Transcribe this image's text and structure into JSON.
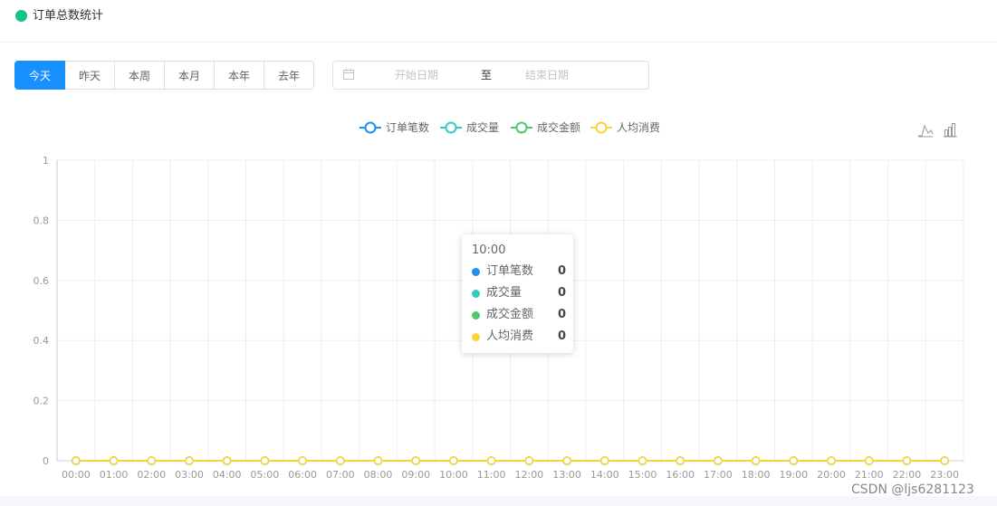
{
  "header": {
    "title": "订单总数统计",
    "dot_color": "#13c28b"
  },
  "buttons": [
    "今天",
    "昨天",
    "本周",
    "本月",
    "本年",
    "去年"
  ],
  "active_button": 0,
  "accent": "#1890ff",
  "date_range": {
    "start_placeholder": "开始日期",
    "separator": "至",
    "end_placeholder": "结束日期"
  },
  "toolbox": [
    "line-icon",
    "bar-icon"
  ],
  "chart_data": {
    "type": "line",
    "x": [
      "00:00",
      "01:00",
      "02:00",
      "03:00",
      "04:00",
      "05:00",
      "06:00",
      "07:00",
      "08:00",
      "09:00",
      "10:00",
      "11:00",
      "12:00",
      "13:00",
      "14:00",
      "15:00",
      "16:00",
      "17:00",
      "18:00",
      "19:00",
      "20:00",
      "21:00",
      "22:00",
      "23:00"
    ],
    "series": [
      {
        "name": "订单笔数",
        "color": "#1e90f0",
        "values": [
          0,
          0,
          0,
          0,
          0,
          0,
          0,
          0,
          0,
          0,
          0,
          0,
          0,
          0,
          0,
          0,
          0,
          0,
          0,
          0,
          0,
          0,
          0,
          0
        ]
      },
      {
        "name": "成交量",
        "color": "#36c9c6",
        "values": [
          0,
          0,
          0,
          0,
          0,
          0,
          0,
          0,
          0,
          0,
          0,
          0,
          0,
          0,
          0,
          0,
          0,
          0,
          0,
          0,
          0,
          0,
          0,
          0
        ]
      },
      {
        "name": "成交金额",
        "color": "#4fc96c",
        "values": [
          0,
          0,
          0,
          0,
          0,
          0,
          0,
          0,
          0,
          0,
          0,
          0,
          0,
          0,
          0,
          0,
          0,
          0,
          0,
          0,
          0,
          0,
          0,
          0
        ]
      },
      {
        "name": "人均消费",
        "color": "#fad337",
        "values": [
          0,
          0,
          0,
          0,
          0,
          0,
          0,
          0,
          0,
          0,
          0,
          0,
          0,
          0,
          0,
          0,
          0,
          0,
          0,
          0,
          0,
          0,
          0,
          0
        ]
      }
    ],
    "ylim": [
      0,
      1
    ],
    "yticks": [
      "0",
      "0.2",
      "0.4",
      "0.6",
      "0.8",
      "1"
    ],
    "grid": true,
    "legend": "top-center"
  },
  "tooltip": {
    "title": "10:00",
    "rows": [
      {
        "name": "订单笔数",
        "value": "0",
        "color": "#1e90f0"
      },
      {
        "name": "成交量",
        "value": "0",
        "color": "#36c9c6"
      },
      {
        "name": "成交金额",
        "value": "0",
        "color": "#4fc96c"
      },
      {
        "name": "人均消费",
        "value": "0",
        "color": "#fad337"
      }
    ]
  },
  "watermark": "CSDN @ljs6281123"
}
